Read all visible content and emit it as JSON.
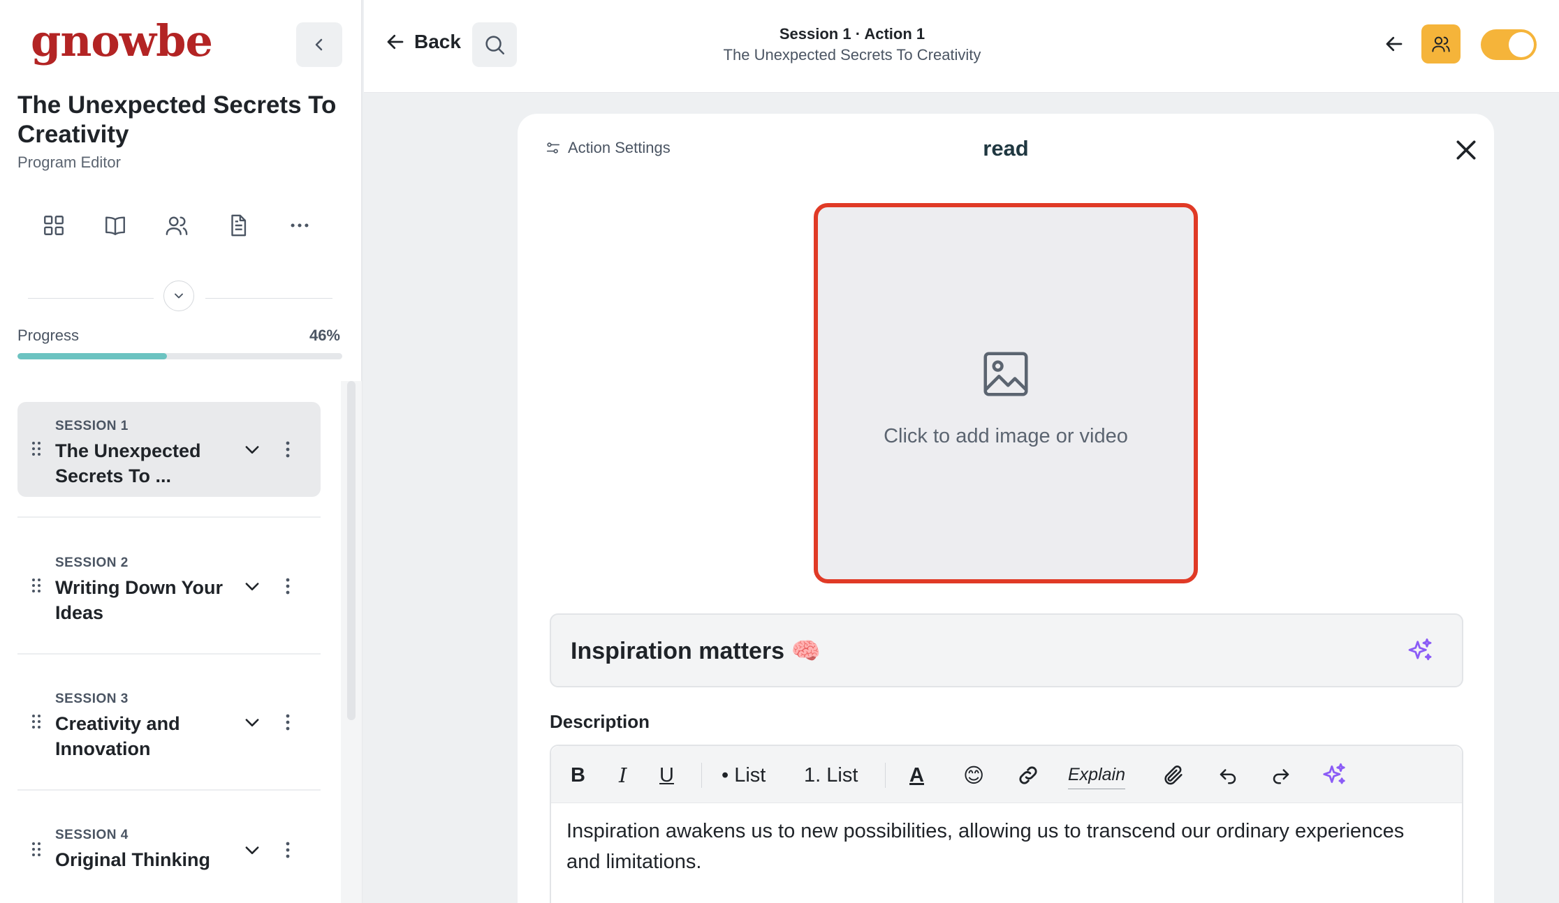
{
  "sidebar": {
    "logo": "gnowbe",
    "program_title": "The Unexpected Secrets To Creativity",
    "program_subtitle": "Program Editor",
    "icons": [
      "grid-icon",
      "book-icon",
      "users-icon",
      "document-icon",
      "more-icon"
    ],
    "progress_label": "Progress",
    "progress_pct_text": "46%",
    "progress_value": 0.46,
    "progress_color": "#6cc3c1",
    "sessions": [
      {
        "label": "SESSION 1",
        "name": "The Unexpected Secrets To ...",
        "active": true
      },
      {
        "label": "SESSION 2",
        "name": "Writing Down Your Ideas",
        "active": false
      },
      {
        "label": "SESSION 3",
        "name": "Creativity and Innovation",
        "active": false
      },
      {
        "label": "SESSION 4",
        "name": "Original Thinking",
        "active": false
      }
    ]
  },
  "topbar": {
    "back_label": "Back",
    "title": "Session 1 · Action 1",
    "subtitle": "The Unexpected Secrets To Creativity",
    "accent_color": "#f5b43a",
    "toggle_on": true
  },
  "card": {
    "settings_label": "Action Settings",
    "title": "read",
    "media_placeholder": "Click to add image or video",
    "media_highlight_color": "#e03a26",
    "action_title": "Inspiration matters 🧠",
    "description_label": "Description",
    "toolbar": {
      "bold": "B",
      "italic": "I",
      "underline": "U",
      "bullet_list": "• List",
      "numbered_list": "1. List",
      "text_color": "A",
      "emoji": "😊",
      "explain": "Explain"
    },
    "description_text": "Inspiration awakens us to new possibilities, allowing us to transcend our ordinary experiences and limitations.",
    "ai_color": "#8b5cf6"
  }
}
